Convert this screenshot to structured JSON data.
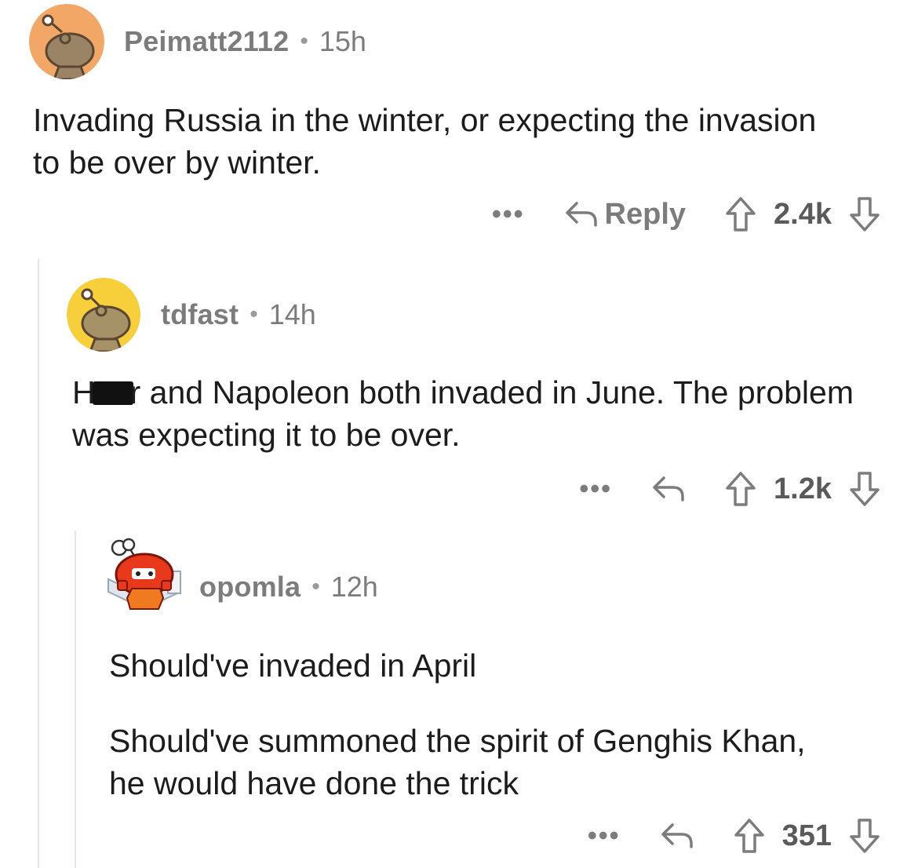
{
  "comments": [
    {
      "username": "Peimatt2112",
      "separator": "•",
      "time": "15h",
      "body": [
        "Invading Russia in the winter, or expecting the invasion to be over by winter."
      ],
      "more": "•••",
      "reply_label": "Reply",
      "score": "2.4k",
      "avatar_color": "#f2a766"
    },
    {
      "username": "tdfast",
      "separator": "•",
      "time": "14h",
      "body_prefix": "H",
      "body_after_redact": "r and Napoleon both invaded in June.  The problem was expecting it to be over.",
      "more": "•••",
      "score": "1.2k",
      "avatar_color": "#f6cf3a"
    },
    {
      "username": "opomla",
      "separator": "•",
      "time": "12h",
      "body": [
        "Should've invaded in April",
        "Should've summoned the spirit of Genghis Khan, he would have done the trick"
      ],
      "more": "•••",
      "score": "351",
      "avatar_color": "#e8391d"
    }
  ],
  "colors": {
    "meta_text": "#7c7c7c",
    "body_text": "#1c1c1c",
    "thread_line": "#e6e6e6"
  }
}
